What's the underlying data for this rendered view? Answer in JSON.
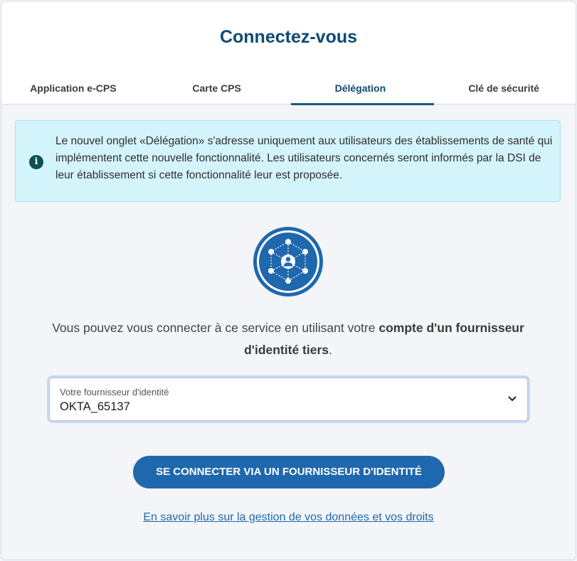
{
  "header": {
    "title": "Connectez-vous",
    "tabs": [
      {
        "label": "Application e-CPS",
        "active": false
      },
      {
        "label": "Carte CPS",
        "active": false
      },
      {
        "label": "Délégation",
        "active": true
      },
      {
        "label": "Clé de sécurité",
        "active": false
      }
    ]
  },
  "info_box": {
    "icon": "info-icon",
    "text": "Le nouvel onglet «Délégation» s'adresse uniquement aux utilisateurs des établissements de santé qui implémentent cette nouvelle fonctionnalité. Les utilisateurs concernés seront informés par la DSI de leur établissement si cette fonctionnalité leur est proposée."
  },
  "emblem": {
    "icon": "identity-network-icon"
  },
  "description": {
    "prefix": "Vous pouvez vous connecter à ce service en utilisant votre ",
    "bold": "compte d'un fournisseur d'identité tiers",
    "suffix": "."
  },
  "provider_select": {
    "label": "Votre fournisseur d'identité",
    "value": "OKTA_65137"
  },
  "connect_button": {
    "label": "SE CONNECTER VIA UN FOURNISSEUR D'IDENTITÉ"
  },
  "privacy_link": {
    "label": "En savoir plus sur la gestion de vos données et vos droits"
  },
  "colors": {
    "title": "#0d4a73",
    "info_bg": "#d3f4fb",
    "button": "#1f68ad",
    "emblem": "#1f68ad"
  }
}
